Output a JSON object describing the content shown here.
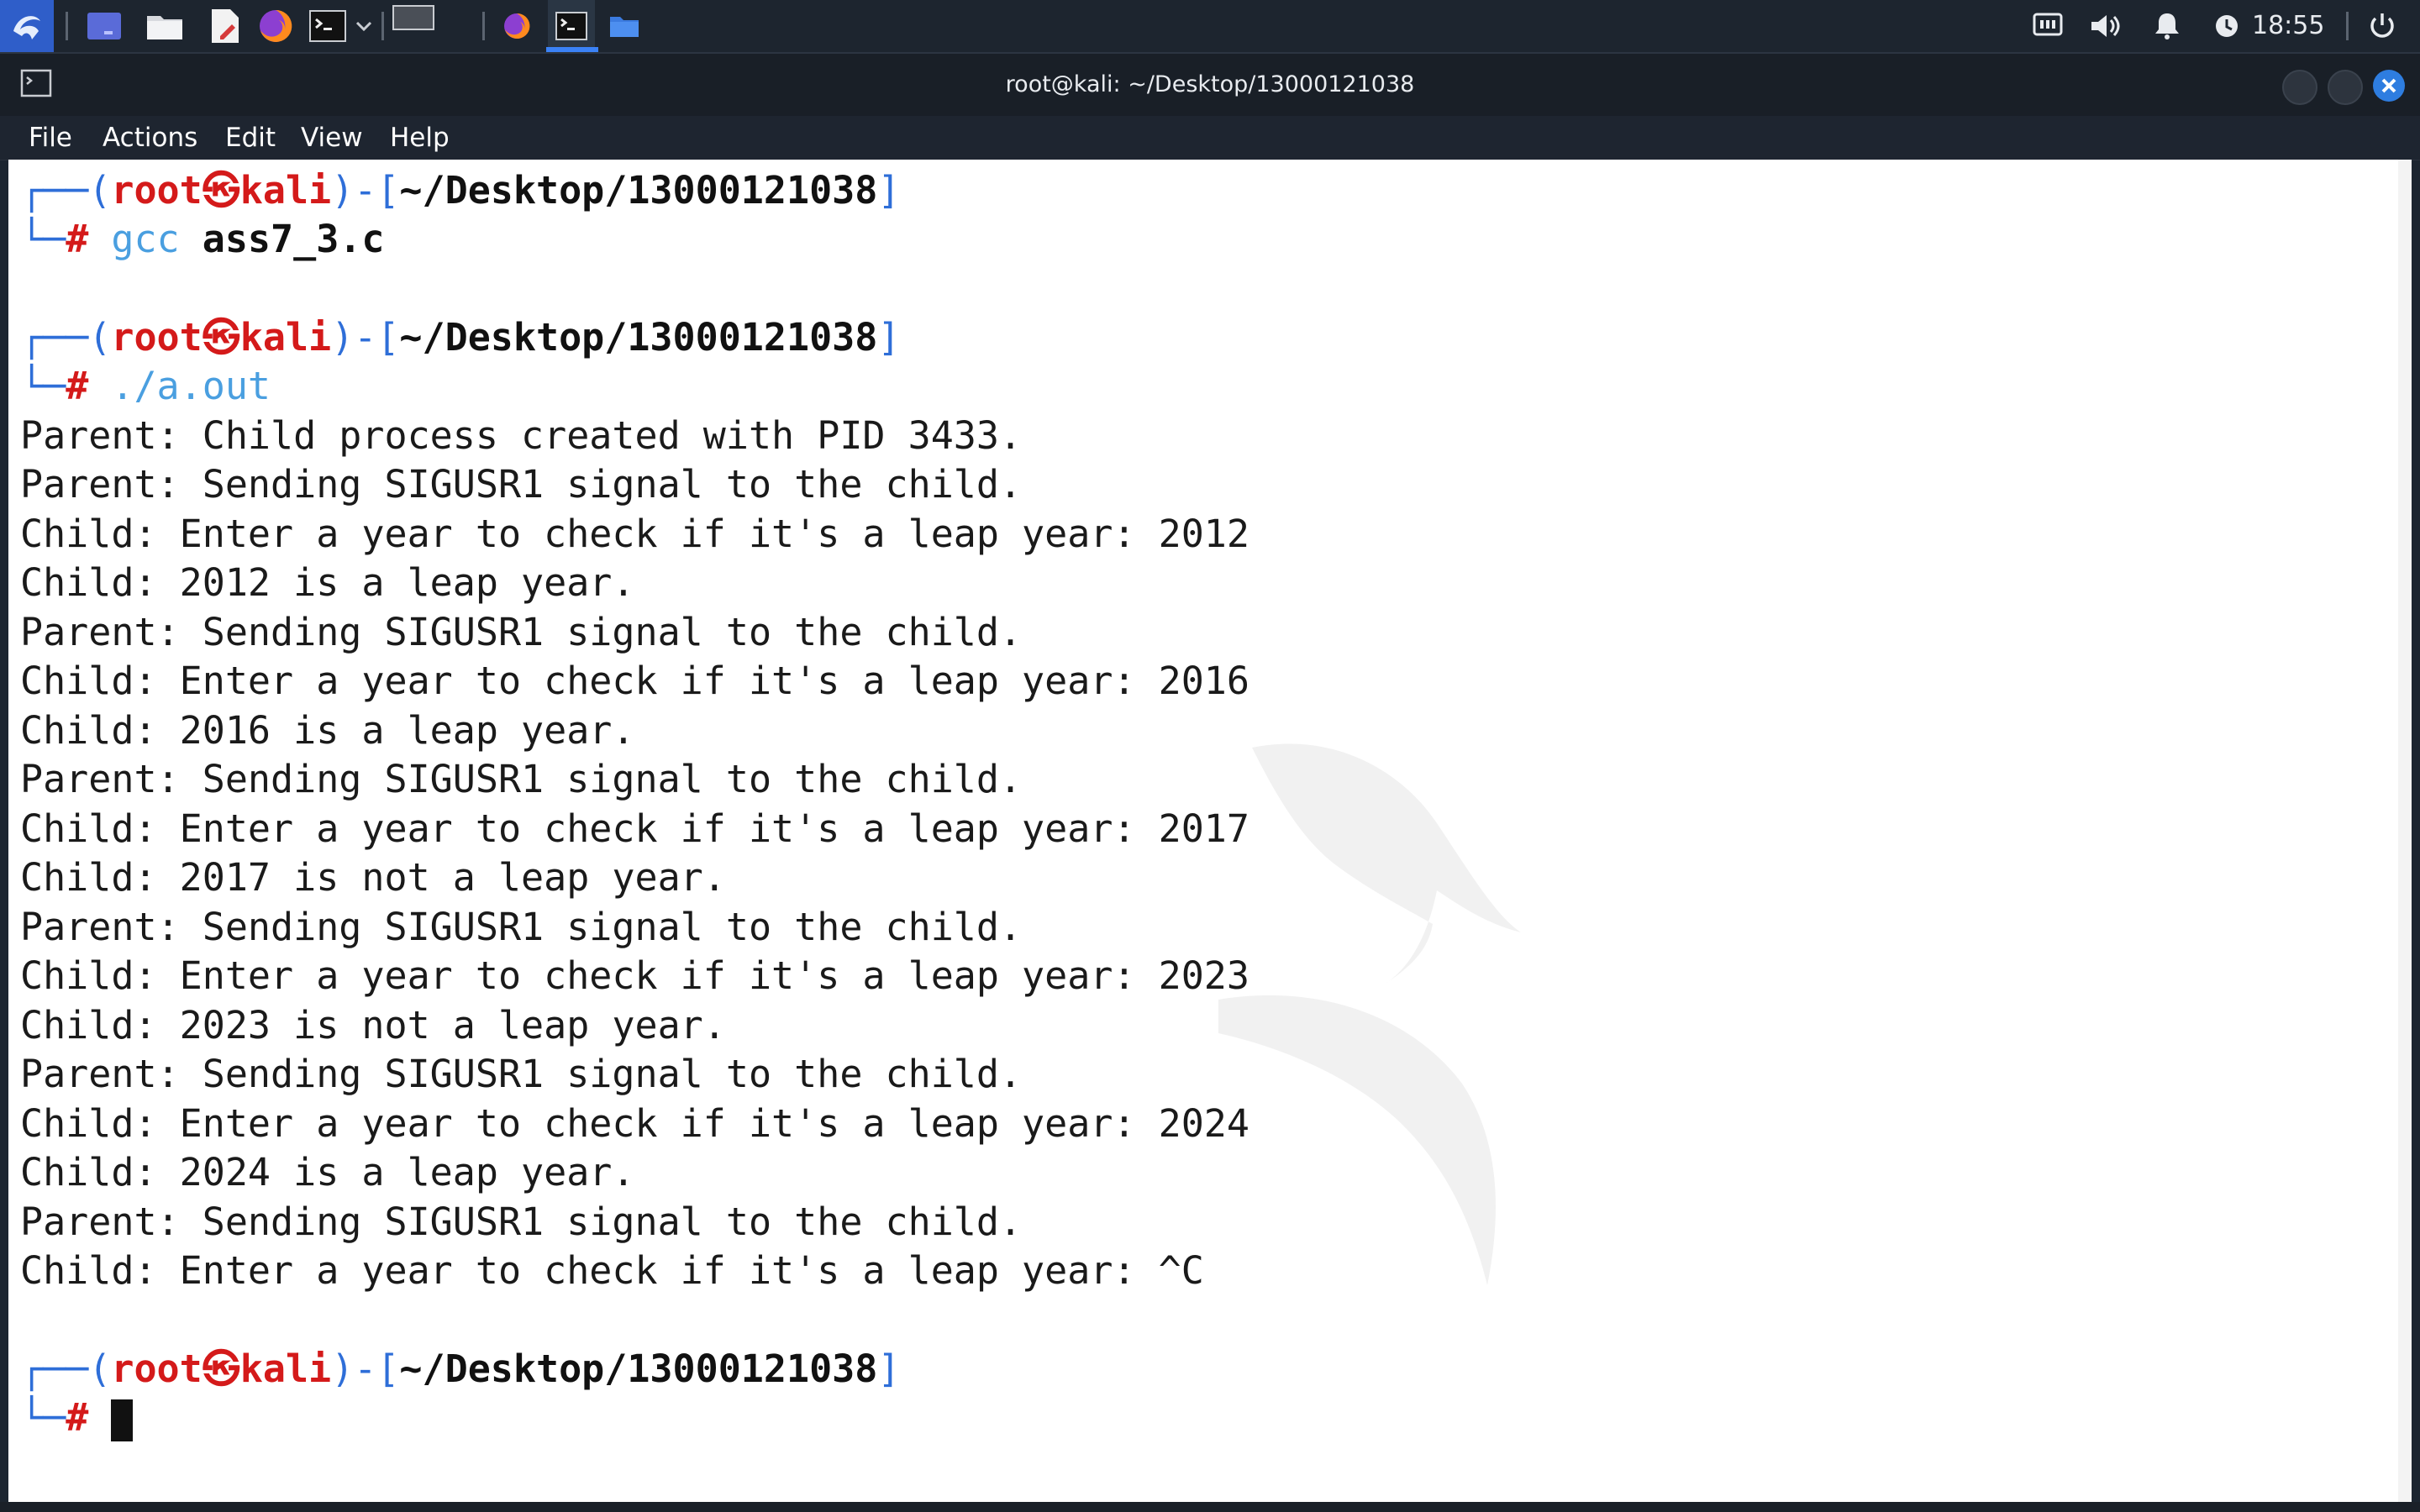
{
  "taskbar": {
    "clock": "18:55",
    "icons": [
      "kali-menu-icon",
      "workspace-icon",
      "file-manager-icon",
      "text-editor-icon",
      "firefox-icon",
      "terminal-icon",
      "chevron-down-icon"
    ]
  },
  "window": {
    "title": "root@kali: ~/Desktop/13000121038"
  },
  "menu": {
    "file": "File",
    "actions": "Actions",
    "edit": "Edit",
    "view": "View",
    "help": "Help"
  },
  "prompt": {
    "user": "root",
    "skull": "㉿",
    "host": "kali",
    "path": "~/Desktop/13000121038",
    "hash": "#"
  },
  "commands": {
    "cmd1_name": "gcc",
    "cmd1_arg": "ass7_3.c",
    "cmd2": "./a.out"
  },
  "output": [
    "Parent: Child process created with PID 3433.",
    "Parent: Sending SIGUSR1 signal to the child.",
    "Child: Enter a year to check if it's a leap year: 2012",
    "Child: 2012 is a leap year.",
    "Parent: Sending SIGUSR1 signal to the child.",
    "Child: Enter a year to check if it's a leap year: 2016",
    "Child: 2016 is a leap year.",
    "Parent: Sending SIGUSR1 signal to the child.",
    "Child: Enter a year to check if it's a leap year: 2017",
    "Child: 2017 is not a leap year.",
    "Parent: Sending SIGUSR1 signal to the child.",
    "Child: Enter a year to check if it's a leap year: 2023",
    "Child: 2023 is not a leap year.",
    "Parent: Sending SIGUSR1 signal to the child.",
    "Child: Enter a year to check if it's a leap year: 2024",
    "Child: 2024 is a leap year.",
    "Parent: Sending SIGUSR1 signal to the child.",
    "Child: Enter a year to check if it's a leap year: ^C"
  ]
}
